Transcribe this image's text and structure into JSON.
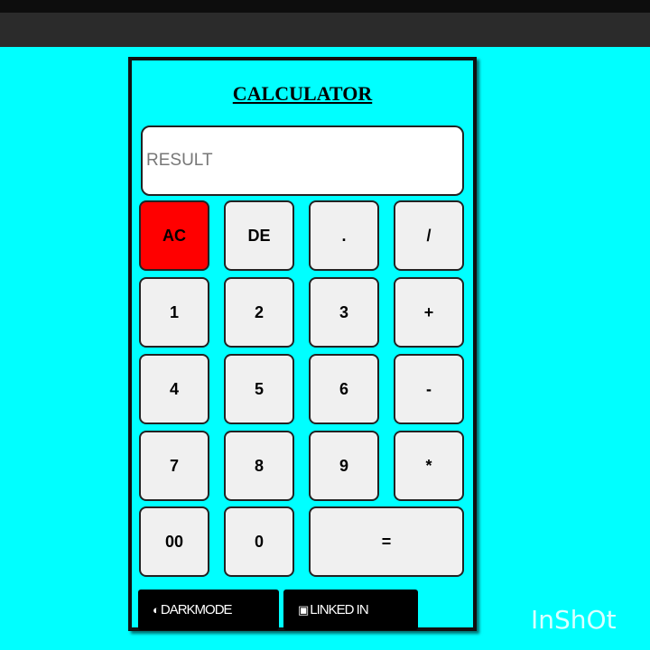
{
  "title": "CALCULATOR",
  "result": {
    "placeholder": "RESULT",
    "value": ""
  },
  "keys": {
    "ac": "AC",
    "de": "DE",
    "dot": ".",
    "divide": "/",
    "one": "1",
    "two": "2",
    "three": "3",
    "plus": "+",
    "four": "4",
    "five": "5",
    "six": "6",
    "minus": "-",
    "seven": "7",
    "eight": "8",
    "nine": "9",
    "multiply": "*",
    "double_zero": "00",
    "zero": "0",
    "equals": "="
  },
  "footer": {
    "darkmode_label": "DARKMODE",
    "darkmode_icon": "half-circle-icon",
    "linkedin_label": "LINKED IN",
    "linkedin_icon": "linkedin-icon"
  },
  "watermark": "InShOt",
  "colors": {
    "background": "#00ffff",
    "ac_key": "#ff0000",
    "key": "#f0f0f0"
  }
}
